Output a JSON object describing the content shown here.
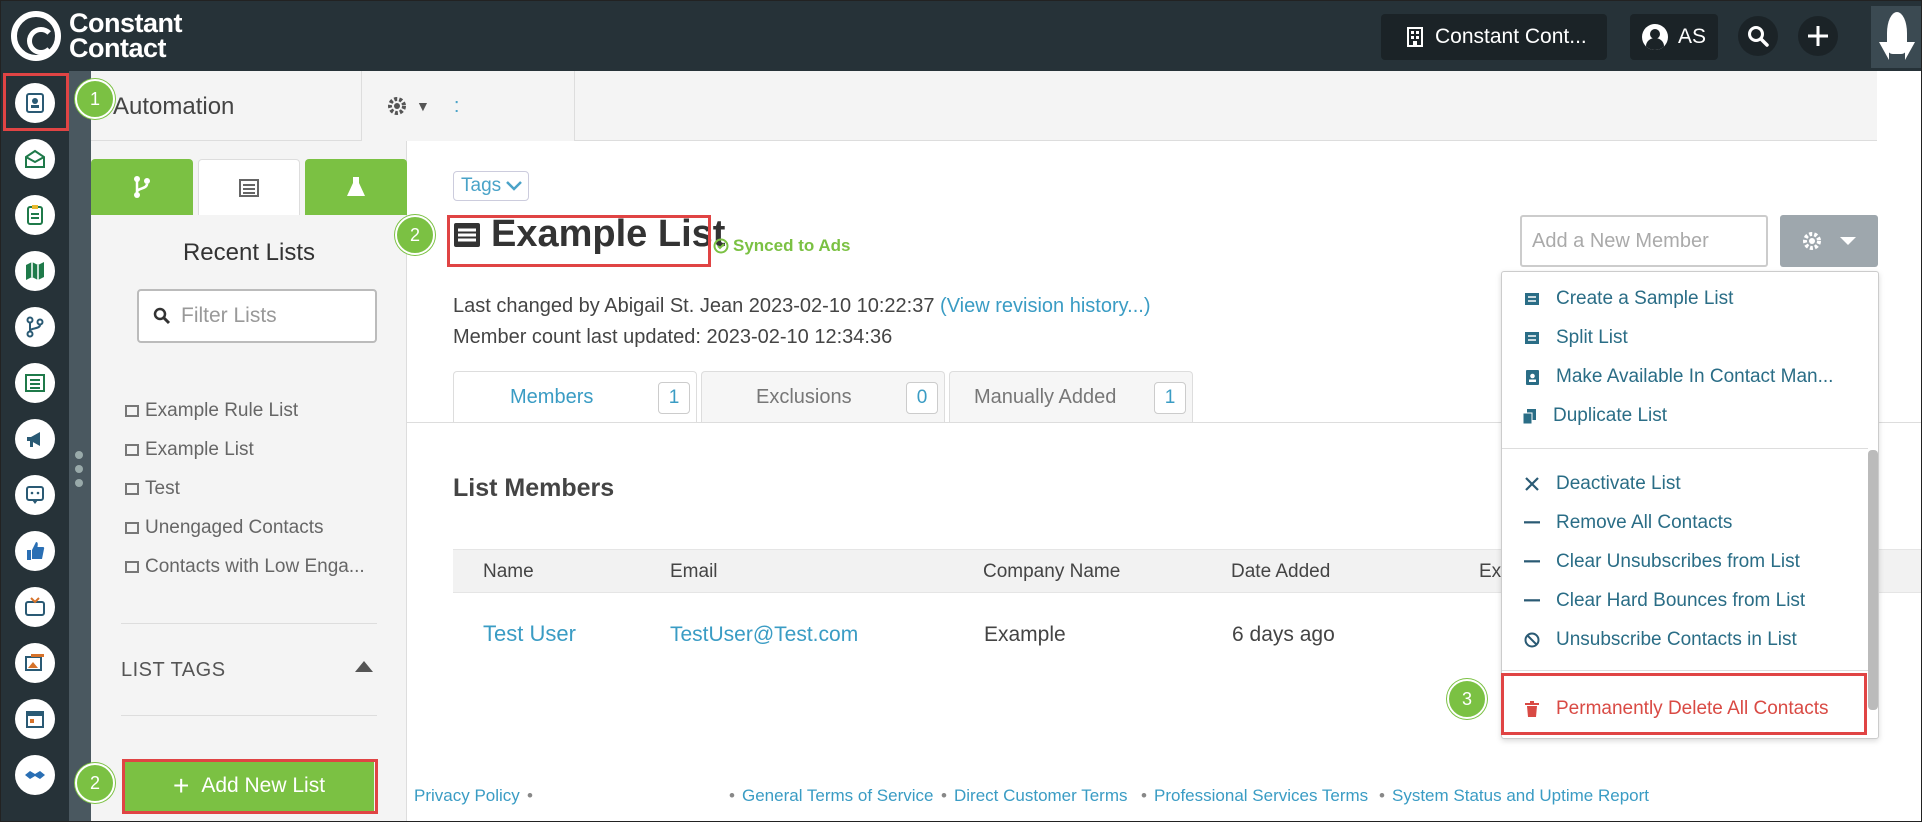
{
  "brand": {
    "line1": "Constant",
    "line2": "Contact"
  },
  "topbar": {
    "account_label": "Constant Cont...",
    "user_initials": "AS"
  },
  "sidebar": {
    "title": "Automation",
    "recent_title": "Recent Lists",
    "filter_placeholder": "Filter Lists",
    "lists": [
      "Example Rule List",
      "Example List",
      "Test",
      "Unengaged Contacts",
      "Contacts with Low Enga..."
    ],
    "list_tags_label": "LIST TAGS",
    "add_list_label": "Add New List"
  },
  "main": {
    "tags_label": "Tags",
    "title": "Example List",
    "synced_label": "Synced to Ads",
    "last_changed": "Last changed by Abigail St. Jean 2023-02-10 10:22:37",
    "revision_link": "(View revision history...)",
    "member_count": "Member count last updated: 2023-02-10 12:34:36",
    "tabs": [
      {
        "label": "Members",
        "count": "1"
      },
      {
        "label": "Exclusions",
        "count": "0"
      },
      {
        "label": "Manually Added",
        "count": "1"
      }
    ],
    "list_members_title": "List Members",
    "columns": [
      "Name",
      "Email",
      "Company Name",
      "Date Added",
      "Ex"
    ],
    "rows": [
      {
        "name": "Test User",
        "email": "TestUser@Test.com",
        "company": "Example",
        "date_added": "6 days ago"
      }
    ],
    "add_member_placeholder": "Add a New Member"
  },
  "dropdown": {
    "items": [
      {
        "label": "Create a Sample List",
        "icon": "list-icon"
      },
      {
        "label": "Split List",
        "icon": "list-icon"
      },
      {
        "label": "Make Available In Contact Man...",
        "icon": "contact-card-icon"
      },
      {
        "label": "Duplicate List",
        "icon": "copy-icon"
      },
      {
        "label": "Deactivate List",
        "icon": "x-icon"
      },
      {
        "label": "Remove All Contacts",
        "icon": "minus-icon"
      },
      {
        "label": "Clear Unsubscribes from List",
        "icon": "minus-icon"
      },
      {
        "label": "Clear Hard Bounces from List",
        "icon": "minus-icon"
      },
      {
        "label": "Unsubscribe Contacts in List",
        "icon": "ban-icon"
      },
      {
        "label": "Permanently Delete All Contacts",
        "icon": "trash-icon"
      }
    ]
  },
  "badges": [
    "1",
    "2",
    "2",
    "3"
  ],
  "footer": {
    "privacy": "Privacy Policy",
    "general_terms": "General Terms of Service",
    "direct_terms": "Direct Customer Terms",
    "professional_terms": "Professional Services Terms",
    "status_report": "System Status and Uptime Report"
  },
  "colors": {
    "topbar": "#263238",
    "accent_green": "#7bc143",
    "link_blue": "#3a9cc4",
    "danger_red": "#d94a44",
    "highlight": "#e04444"
  }
}
